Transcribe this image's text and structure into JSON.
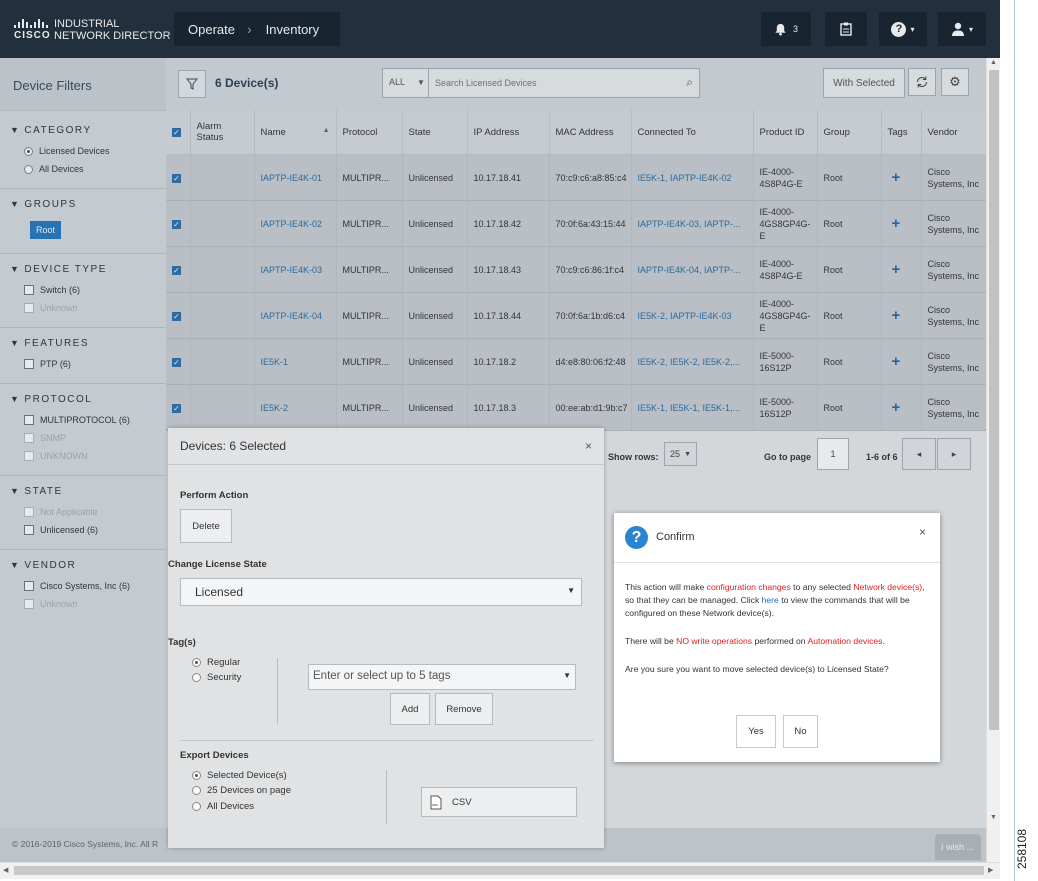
{
  "header": {
    "brand_line1": "INDUSTRIAL",
    "brand_line2": "NETWORK DIRECTOR",
    "cisco": "CISCO",
    "crumb1": "Operate",
    "crumb2": "Inventory",
    "alarm_count": "3",
    "help_icon": "question-icon",
    "user_icon": "user-icon"
  },
  "filters": {
    "title": "Device Filters",
    "category_title": "CATEGORY",
    "category_items": [
      "Licensed Devices",
      "All Devices"
    ],
    "groups_title": "GROUPS",
    "group_root": "Root",
    "device_type_title": "DEVICE TYPE",
    "device_type_items": [
      "Switch (6)",
      "Unknown"
    ],
    "features_title": "FEATURES",
    "features_items": [
      "PTP (6)"
    ],
    "protocol_title": "PROTOCOL",
    "protocol_items": [
      "MULTIPROTOCOL (6)",
      "SNMP",
      "UNKNOWN"
    ],
    "state_title": "STATE",
    "state_items": [
      "Not Applicable",
      "Unlicensed (6)"
    ],
    "vendor_title": "VENDOR",
    "vendor_items": [
      "Cisco Systems, Inc (6)",
      "Unknown"
    ]
  },
  "toolbar": {
    "device_count": "6 Device(s)",
    "search_scope": "ALL",
    "search_placeholder": "Search Licensed Devices",
    "with_selected": "With Selected"
  },
  "table": {
    "headers": [
      "Alarm Status",
      "Name",
      "Protocol",
      "State",
      "IP Address",
      "MAC Address",
      "Connected To",
      "Product ID",
      "Group",
      "Tags",
      "Vendor"
    ],
    "rows": [
      {
        "name": "IAPTP-IE4K-01",
        "protocol": "MULTIPR...",
        "state": "Unlicensed",
        "ip": "10.17.18.41",
        "mac": "70:c9:c6:a8:85:c4",
        "connected": "IE5K-1, IAPTP-IE4K-02",
        "product": "IE-4000-4S8P4G-E",
        "group": "Root",
        "vendor": "Cisco Systems, Inc"
      },
      {
        "name": "IAPTP-IE4K-02",
        "protocol": "MULTIPR...",
        "state": "Unlicensed",
        "ip": "10.17.18.42",
        "mac": "70:0f:6a:43:15:44",
        "connected": "IAPTP-IE4K-03, IAPTP-...",
        "product": "IE-4000-4GS8GP4G-E",
        "group": "Root",
        "vendor": "Cisco Systems, Inc"
      },
      {
        "name": "IAPTP-IE4K-03",
        "protocol": "MULTIPR...",
        "state": "Unlicensed",
        "ip": "10.17.18.43",
        "mac": "70:c9:c6:86:1f:c4",
        "connected": "IAPTP-IE4K-04, IAPTP-...",
        "product": "IE-4000-4S8P4G-E",
        "group": "Root",
        "vendor": "Cisco Systems, Inc"
      },
      {
        "name": "IAPTP-IE4K-04",
        "protocol": "MULTIPR...",
        "state": "Unlicensed",
        "ip": "10.17.18.44",
        "mac": "70:0f:6a:1b:d6:c4",
        "connected": "IE5K-2, IAPTP-IE4K-03",
        "product": "IE-4000-4GS8GP4G-E",
        "group": "Root",
        "vendor": "Cisco Systems, Inc"
      },
      {
        "name": "IE5K-1",
        "protocol": "MULTIPR...",
        "state": "Unlicensed",
        "ip": "10.17.18.2",
        "mac": "d4:e8:80:06:f2:48",
        "connected": "IE5K-2, IE5K-2, IE5K-2,...",
        "product": "IE-5000-16S12P",
        "group": "Root",
        "vendor": "Cisco Systems, Inc"
      },
      {
        "name": "IE5K-2",
        "protocol": "MULTIPR...",
        "state": "Unlicensed",
        "ip": "10.17.18.3",
        "mac": "00:ee:ab:d1:9b:c7",
        "connected": "IE5K-1, IE5K-1, IE5K-1,...",
        "product": "IE-5000-16S12P",
        "group": "Root",
        "vendor": "Cisco Systems, Inc"
      }
    ]
  },
  "pager": {
    "show_rows_label": "Show rows:",
    "rows_value": "25",
    "goto_label": "Go to page",
    "page_value": "1",
    "range": "1-6 of 6"
  },
  "devices_modal": {
    "title": "Devices: 6 Selected",
    "perform_action": "Perform Action",
    "delete": "Delete",
    "change_license": "Change License State",
    "license_value": "Licensed",
    "tags_label": "Tag(s)",
    "tag_regular": "Regular",
    "tag_security": "Security",
    "tags_placeholder": "Enter or select up to 5 tags",
    "add": "Add",
    "remove": "Remove",
    "export_label": "Export Devices",
    "export_selected": "Selected Device(s)",
    "export_page": "25 Devices on page",
    "export_all": "All Devices",
    "csv": "CSV"
  },
  "confirm": {
    "title": "Confirm",
    "p1_a": "This action will make ",
    "p1_b": "configuration changes",
    "p1_c": " to any selected ",
    "p1_d": "Network device(s)",
    "p1_e": ", so that they can be managed. Click ",
    "p1_f": "here",
    "p1_g": " to view the commands that will be configured on these Network device(s).",
    "p2_a": "There will be ",
    "p2_b": "NO write operations",
    "p2_c": " performed on ",
    "p2_d": "Automation devices",
    "p2_e": ".",
    "p3": "Are you sure you want to move selected device(s) to Licensed State?",
    "yes": "Yes",
    "no": "No"
  },
  "footer": {
    "copyright": "© 2016-2019 Cisco Systems, Inc. All R",
    "iwish": "I wish ..."
  },
  "side_id": "258108"
}
